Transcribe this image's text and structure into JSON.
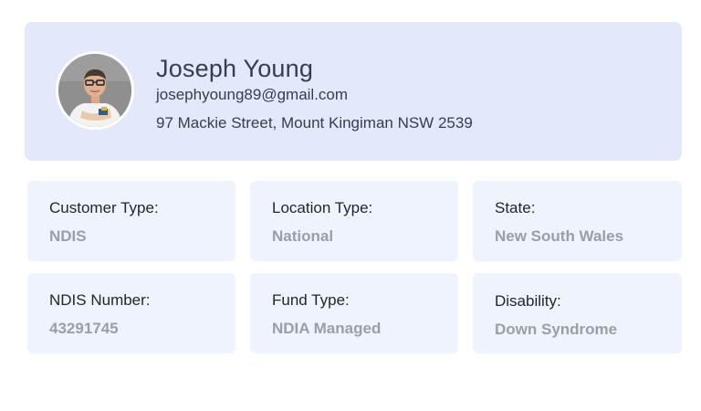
{
  "profile": {
    "name": "Joseph Young",
    "email": "josephyoung89@gmail.com",
    "address": "97 Mackie Street, Mount Kingiman NSW 2539",
    "avatar_icon": "user-photo",
    "card_bg": "#e3e8fb"
  },
  "details": [
    {
      "label": "Customer Type:",
      "value": "NDIS"
    },
    {
      "label": "Location Type:",
      "value": "National"
    },
    {
      "label": "State:",
      "value": "New South Wales"
    },
    {
      "label": "NDIS Number:",
      "value": "43291745"
    },
    {
      "label": "Fund Type:",
      "value": "NDIA Managed"
    },
    {
      "label": "Disability:",
      "value": "Down Syndrome"
    }
  ],
  "colors": {
    "label_text": "#1f2430",
    "value_text": "#9a9ea6",
    "info_card_bg": "#eff3fd"
  }
}
